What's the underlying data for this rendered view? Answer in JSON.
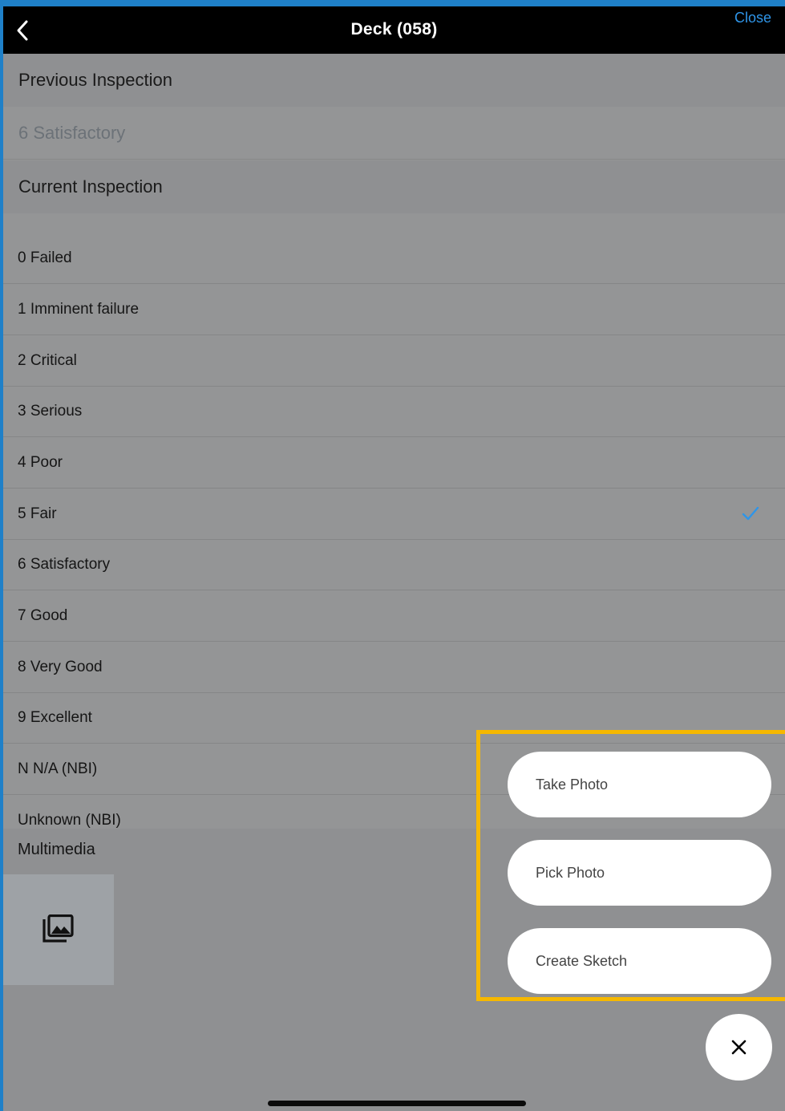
{
  "nav": {
    "title": "Deck (058)",
    "close_label": "Close",
    "back_icon": "chevron-left-icon"
  },
  "previous_inspection": {
    "header": "Previous Inspection",
    "value": "6 Satisfactory"
  },
  "current_inspection": {
    "header": "Current Inspection",
    "options": [
      {
        "label": "0 Failed",
        "selected": false
      },
      {
        "label": "1 Imminent failure",
        "selected": false
      },
      {
        "label": "2 Critical",
        "selected": false
      },
      {
        "label": "3 Serious",
        "selected": false
      },
      {
        "label": "4 Poor",
        "selected": false
      },
      {
        "label": "5 Fair",
        "selected": true
      },
      {
        "label": "6 Satisfactory",
        "selected": false
      },
      {
        "label": "7 Good",
        "selected": false
      },
      {
        "label": "8 Very Good",
        "selected": false
      },
      {
        "label": "9 Excellent",
        "selected": false
      },
      {
        "label": "N N/A (NBI)",
        "selected": false
      },
      {
        "label": "Unknown (NBI)",
        "selected": false
      }
    ]
  },
  "multimedia": {
    "label": "Multimedia",
    "gallery_icon": "photo-library-icon"
  },
  "action_menu": {
    "take_photo": "Take Photo",
    "pick_photo": "Pick Photo",
    "create_sketch": "Create Sketch",
    "close_icon": "close-icon"
  },
  "colors": {
    "accent": "#2f95e8",
    "highlight": "#f6b800",
    "frame": "#1f80c8"
  }
}
